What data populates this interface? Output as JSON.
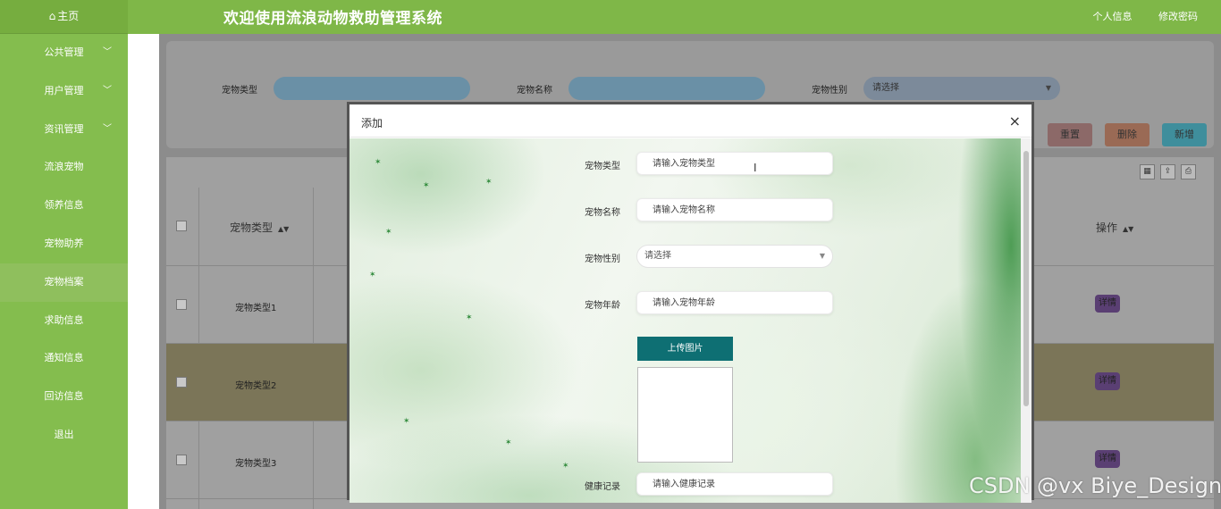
{
  "header": {
    "home": "主页",
    "home_icon": "home-icon",
    "title": "欢迎使用流浪动物救助管理系统",
    "profile": "个人信息",
    "change_password": "修改密码"
  },
  "sidebar": {
    "items": [
      {
        "label": "公共管理",
        "expandable": true
      },
      {
        "label": "用户管理",
        "expandable": true
      },
      {
        "label": "资讯管理",
        "expandable": true
      },
      {
        "label": "流浪宠物"
      },
      {
        "label": "领养信息"
      },
      {
        "label": "宠物助养"
      },
      {
        "label": "宠物档案",
        "active": true
      },
      {
        "label": "求助信息"
      },
      {
        "label": "通知信息"
      },
      {
        "label": "回访信息"
      },
      {
        "label": "退出"
      }
    ]
  },
  "search": {
    "pet_type_label": "宠物类型",
    "pet_name_label": "宠物名称",
    "pet_gender_label": "宠物性别",
    "gender_select_value": "请选择"
  },
  "toolbar": {
    "reset": "重置",
    "delete": "删除",
    "add": "新增"
  },
  "table": {
    "columns": {
      "pet_type": "宠物类型",
      "operation": "操作"
    },
    "rows": [
      {
        "pet_type": "宠物类型1",
        "action": "详情"
      },
      {
        "pet_type": "宠物类型2",
        "action": "详情"
      },
      {
        "pet_type": "宠物类型3",
        "action": "详情"
      }
    ],
    "tool_icons": [
      "grid-icon",
      "export-icon",
      "print-icon"
    ]
  },
  "modal": {
    "title": "添加",
    "close": "×",
    "fields": {
      "pet_type": {
        "label": "宠物类型",
        "placeholder": "请输入宠物类型"
      },
      "pet_name": {
        "label": "宠物名称",
        "placeholder": "请输入宠物名称"
      },
      "pet_gender": {
        "label": "宠物性别",
        "value": "请选择"
      },
      "pet_age": {
        "label": "宠物年龄",
        "placeholder": "请输入宠物年龄"
      },
      "health": {
        "label": "健康记录",
        "placeholder": "请输入健康记录"
      }
    },
    "upload_label": "上传图片"
  },
  "watermark": "CSDN @vx Biye_Design",
  "colors": {
    "header_green": "#7fb748",
    "sidebar_green": "#84bd4e",
    "upload_teal": "#0e6f73"
  }
}
